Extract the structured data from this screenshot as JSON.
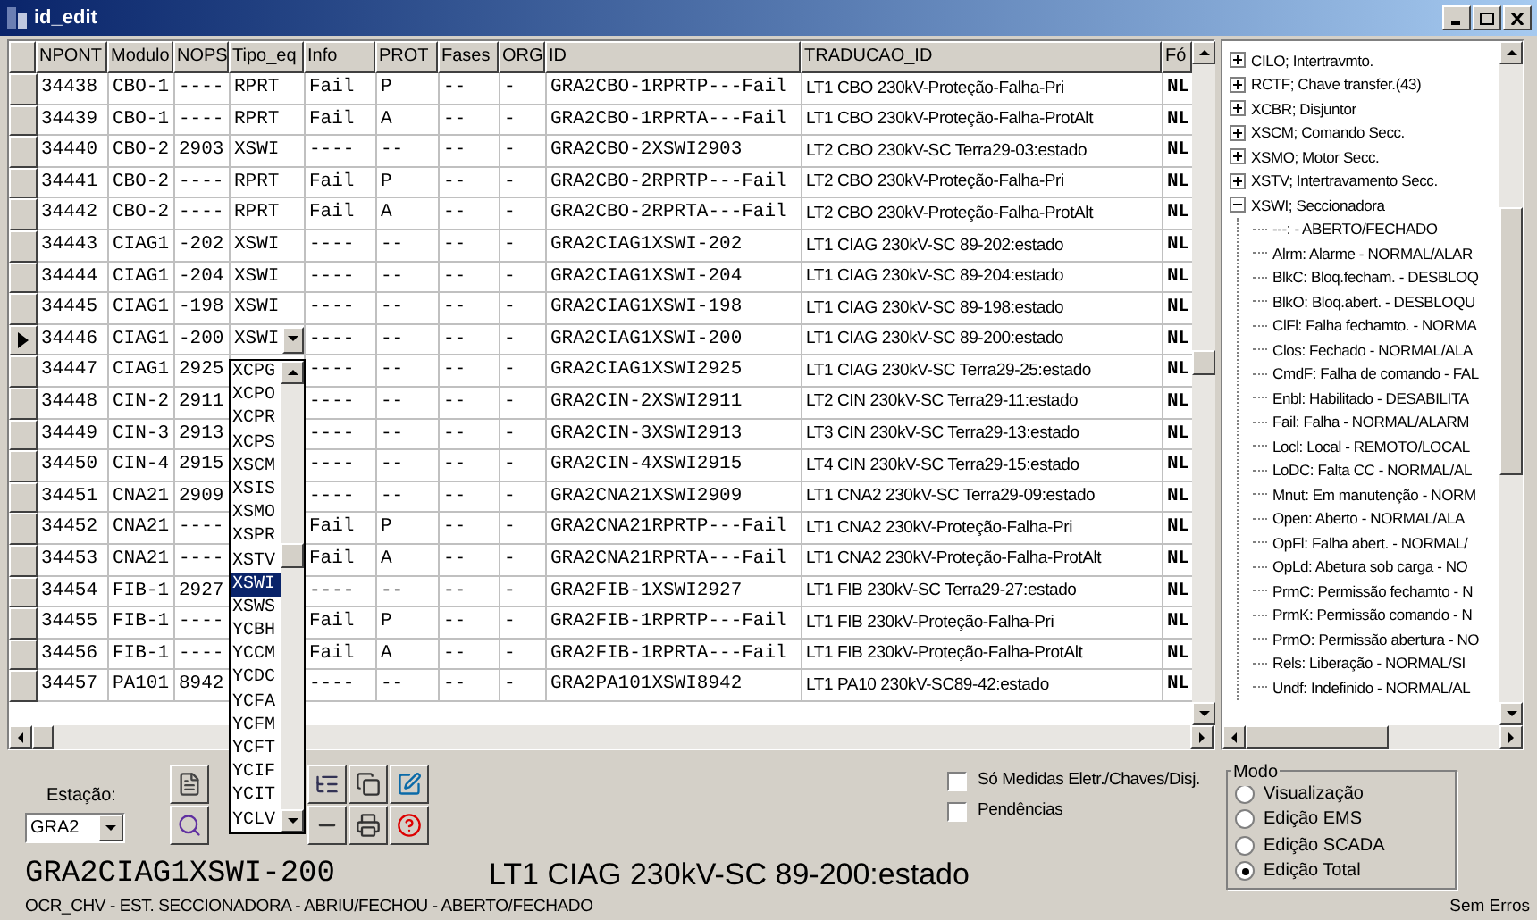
{
  "window": {
    "title": "id_edit"
  },
  "table": {
    "columns": [
      "NPONT",
      "Modulo",
      "NOPS",
      "Tipo_eq",
      "Info",
      "PROT",
      "Fases",
      "ORG",
      "ID",
      "TRADUCAO_ID",
      "Fó"
    ],
    "rows": [
      {
        "selected": false,
        "npont": "34438",
        "modulo": "CBO-1",
        "nops": "----",
        "tipo_eq": "RPRT",
        "info": "Fail",
        "prot": "P",
        "fases": "--",
        "org": "-",
        "id": "GRA2CBO-1RPRTP---Fail",
        "traducao_id": "LT1 CBO 230kV-Proteção-Falha-Pri",
        "fo": "NL"
      },
      {
        "selected": false,
        "npont": "34439",
        "modulo": "CBO-1",
        "nops": "----",
        "tipo_eq": "RPRT",
        "info": "Fail",
        "prot": "A",
        "fases": "--",
        "org": "-",
        "id": "GRA2CBO-1RPRTA---Fail",
        "traducao_id": "LT1 CBO 230kV-Proteção-Falha-ProtAlt",
        "fo": "NL"
      },
      {
        "selected": false,
        "npont": "34440",
        "modulo": "CBO-2",
        "nops": "2903",
        "tipo_eq": "XSWI",
        "info": "----",
        "prot": "--",
        "fases": "--",
        "org": "-",
        "id": "GRA2CBO-2XSWI2903",
        "traducao_id": "LT2 CBO 230kV-SC Terra29-03:estado",
        "fo": "NL"
      },
      {
        "selected": false,
        "npont": "34441",
        "modulo": "CBO-2",
        "nops": "----",
        "tipo_eq": "RPRT",
        "info": "Fail",
        "prot": "P",
        "fases": "--",
        "org": "-",
        "id": "GRA2CBO-2RPRTP---Fail",
        "traducao_id": "LT2 CBO 230kV-Proteção-Falha-Pri",
        "fo": "NL"
      },
      {
        "selected": false,
        "npont": "34442",
        "modulo": "CBO-2",
        "nops": "----",
        "tipo_eq": "RPRT",
        "info": "Fail",
        "prot": "A",
        "fases": "--",
        "org": "-",
        "id": "GRA2CBO-2RPRTA---Fail",
        "traducao_id": "LT2 CBO 230kV-Proteção-Falha-ProtAlt",
        "fo": "NL"
      },
      {
        "selected": false,
        "npont": "34443",
        "modulo": "CIAG1",
        "nops": "-202",
        "tipo_eq": "XSWI",
        "info": "----",
        "prot": "--",
        "fases": "--",
        "org": "-",
        "id": "GRA2CIAG1XSWI-202",
        "traducao_id": "LT1 CIAG 230kV-SC 89-202:estado",
        "fo": "NL"
      },
      {
        "selected": false,
        "npont": "34444",
        "modulo": "CIAG1",
        "nops": "-204",
        "tipo_eq": "XSWI",
        "info": "----",
        "prot": "--",
        "fases": "--",
        "org": "-",
        "id": "GRA2CIAG1XSWI-204",
        "traducao_id": "LT1 CIAG 230kV-SC 89-204:estado",
        "fo": "NL"
      },
      {
        "selected": false,
        "npont": "34445",
        "modulo": "CIAG1",
        "nops": "-198",
        "tipo_eq": "XSWI",
        "info": "----",
        "prot": "--",
        "fases": "--",
        "org": "-",
        "id": "GRA2CIAG1XSWI-198",
        "traducao_id": "LT1 CIAG 230kV-SC 89-198:estado",
        "fo": "NL"
      },
      {
        "selected": true,
        "npont": "34446",
        "modulo": "CIAG1",
        "nops": "-200",
        "tipo_eq": "XSWI",
        "info": "----",
        "prot": "--",
        "fases": "--",
        "org": "-",
        "id": "GRA2CIAG1XSWI-200",
        "traducao_id": "LT1 CIAG 230kV-SC 89-200:estado",
        "fo": "NL"
      },
      {
        "selected": false,
        "npont": "34447",
        "modulo": "CIAG1",
        "nops": "2925",
        "info": "----",
        "prot": "--",
        "fases": "--",
        "org": "-",
        "id": "GRA2CIAG1XSWI2925",
        "traducao_id": "LT1 CIAG 230kV-SC Terra29-25:estado",
        "fo": "NL"
      },
      {
        "selected": false,
        "npont": "34448",
        "modulo": "CIN-2",
        "nops": "2911",
        "info": "----",
        "prot": "--",
        "fases": "--",
        "org": "-",
        "id": "GRA2CIN-2XSWI2911",
        "traducao_id": "LT2 CIN 230kV-SC Terra29-11:estado",
        "fo": "NL"
      },
      {
        "selected": false,
        "npont": "34449",
        "modulo": "CIN-3",
        "nops": "2913",
        "info": "----",
        "prot": "--",
        "fases": "--",
        "org": "-",
        "id": "GRA2CIN-3XSWI2913",
        "traducao_id": "LT3 CIN 230kV-SC Terra29-13:estado",
        "fo": "NL"
      },
      {
        "selected": false,
        "npont": "34450",
        "modulo": "CIN-4",
        "nops": "2915",
        "info": "----",
        "prot": "--",
        "fases": "--",
        "org": "-",
        "id": "GRA2CIN-4XSWI2915",
        "traducao_id": "LT4 CIN 230kV-SC Terra29-15:estado",
        "fo": "NL"
      },
      {
        "selected": false,
        "npont": "34451",
        "modulo": "CNA21",
        "nops": "2909",
        "info": "----",
        "prot": "--",
        "fases": "--",
        "org": "-",
        "id": "GRA2CNA21XSWI2909",
        "traducao_id": "LT1 CNA2 230kV-SC Terra29-09:estado",
        "fo": "NL"
      },
      {
        "selected": false,
        "npont": "34452",
        "modulo": "CNA21",
        "nops": "----",
        "info": "Fail",
        "prot": "P",
        "fases": "--",
        "org": "-",
        "id": "GRA2CNA21RPRTP---Fail",
        "traducao_id": "LT1 CNA2 230kV-Proteção-Falha-Pri",
        "fo": "NL"
      },
      {
        "selected": false,
        "npont": "34453",
        "modulo": "CNA21",
        "nops": "----",
        "info": "Fail",
        "prot": "A",
        "fases": "--",
        "org": "-",
        "id": "GRA2CNA21RPRTA---Fail",
        "traducao_id": "LT1 CNA2 230kV-Proteção-Falha-ProtAlt",
        "fo": "NL"
      },
      {
        "selected": false,
        "npont": "34454",
        "modulo": "FIB-1",
        "nops": "2927",
        "info": "----",
        "prot": "--",
        "fases": "--",
        "org": "-",
        "id": "GRA2FIB-1XSWI2927",
        "traducao_id": "LT1 FIB 230kV-SC Terra29-27:estado",
        "fo": "NL"
      },
      {
        "selected": false,
        "npont": "34455",
        "modulo": "FIB-1",
        "nops": "----",
        "info": "Fail",
        "prot": "P",
        "fases": "--",
        "org": "-",
        "id": "GRA2FIB-1RPRTP---Fail",
        "traducao_id": "LT1 FIB 230kV-Proteção-Falha-Pri",
        "fo": "NL"
      },
      {
        "selected": false,
        "npont": "34456",
        "modulo": "FIB-1",
        "nops": "----",
        "info": "Fail",
        "prot": "A",
        "fases": "--",
        "org": "-",
        "id": "GRA2FIB-1RPRTA---Fail",
        "traducao_id": "LT1 FIB 230kV-Proteção-Falha-ProtAlt",
        "fo": "NL"
      },
      {
        "selected": false,
        "npont": "34457",
        "modulo": "PA101",
        "nops": "8942",
        "info": "----",
        "prot": "--",
        "fases": "--",
        "org": "-",
        "id": "GRA2PA101XSWI8942",
        "traducao_id": "LT1 PA10 230kV-SC89-42:estado",
        "fo": "NL"
      }
    ]
  },
  "dropdown": {
    "items": [
      {
        "label": "XCPG",
        "selected": false
      },
      {
        "label": "XCPO",
        "selected": false
      },
      {
        "label": "XCPR",
        "selected": false
      },
      {
        "label": "XCPS",
        "selected": false
      },
      {
        "label": "XSCM",
        "selected": false
      },
      {
        "label": "XSIS",
        "selected": false
      },
      {
        "label": "XSMO",
        "selected": false
      },
      {
        "label": "XSPR",
        "selected": false
      },
      {
        "label": "XSTV",
        "selected": false
      },
      {
        "label": "XSWI",
        "selected": true
      },
      {
        "label": "XSWS",
        "selected": false
      },
      {
        "label": "YCBH",
        "selected": false
      },
      {
        "label": "YCCM",
        "selected": false
      },
      {
        "label": "YCDC",
        "selected": false
      },
      {
        "label": "YCFA",
        "selected": false
      },
      {
        "label": "YCFM",
        "selected": false
      },
      {
        "label": "YCFT",
        "selected": false
      },
      {
        "label": "YCIF",
        "selected": false
      },
      {
        "label": "YCIT",
        "selected": false
      },
      {
        "label": "YCLV",
        "selected": false
      }
    ]
  },
  "tree": {
    "items": [
      {
        "label": "CILO; Intertravmto.",
        "expanded": false
      },
      {
        "label": "RCTF; Chave transfer.(43)",
        "expanded": false
      },
      {
        "label": "XCBR; Disjuntor",
        "expanded": false
      },
      {
        "label": "XSCM; Comando Secc.",
        "expanded": false
      },
      {
        "label": "XSMO; Motor Secc.",
        "expanded": false
      },
      {
        "label": "XSTV; Intertravamento Secc.",
        "expanded": false
      },
      {
        "label": "XSWI; Seccionadora",
        "expanded": true,
        "children": [
          {
            "label": "---: - ABERTO/FECHADO"
          },
          {
            "label": "Alrm: Alarme - NORMAL/ALAR"
          },
          {
            "label": "BlkC: Bloq.fecham. - DESBLOQ"
          },
          {
            "label": "BlkO: Bloq.abert. - DESBLOQU"
          },
          {
            "label": "ClFl: Falha fechamto. - NORMA"
          },
          {
            "label": "Clos: Fechado - NORMAL/ALA"
          },
          {
            "label": "CmdF: Falha de comando - FAL"
          },
          {
            "label": "Enbl: Habilitado - DESABILITA"
          },
          {
            "label": "Fail: Falha - NORMAL/ALARM"
          },
          {
            "label": "Locl: Local - REMOTO/LOCAL"
          },
          {
            "label": "LoDC: Falta CC - NORMAL/AL"
          },
          {
            "label": "Mnut: Em manutenção - NORM"
          },
          {
            "label": "Open: Aberto - NORMAL/ALA"
          },
          {
            "label": "OpFl: Falha abert. - NORMAL/"
          },
          {
            "label": "OpLd: Abetura sob carga - NO"
          },
          {
            "label": "PrmC: Permissão fechamto - N"
          },
          {
            "label": "PrmK: Permissão comando - N"
          },
          {
            "label": "PrmO: Permissão abertura - NO"
          },
          {
            "label": "Rels: Liberação - NORMAL/SI"
          },
          {
            "label": "Undf: Indefinido - NORMAL/AL"
          }
        ]
      }
    ]
  },
  "station": {
    "label": "Estação:",
    "value": "GRA2"
  },
  "filters": [
    {
      "label": "Só Medidas Eletr./Chaves/Disj.",
      "checked": false
    },
    {
      "label": "Pendências",
      "checked": false
    }
  ],
  "mode": {
    "title": "Modo",
    "options": [
      {
        "label": "Visualização",
        "selected": false
      },
      {
        "label": "Edição EMS",
        "selected": false
      },
      {
        "label": "Edição SCADA",
        "selected": false
      },
      {
        "label": "Edição Total",
        "selected": true
      }
    ]
  },
  "current": {
    "id": "GRA2CIAG1XSWI-200",
    "traducao_id": "LT1 CIAG 230kV-SC 89-200:estado",
    "description": "OCR_CHV - EST. SECCIONADORA - ABRIU/FECHOU - ABERTO/FECHADO"
  },
  "status": "Sem Erros"
}
